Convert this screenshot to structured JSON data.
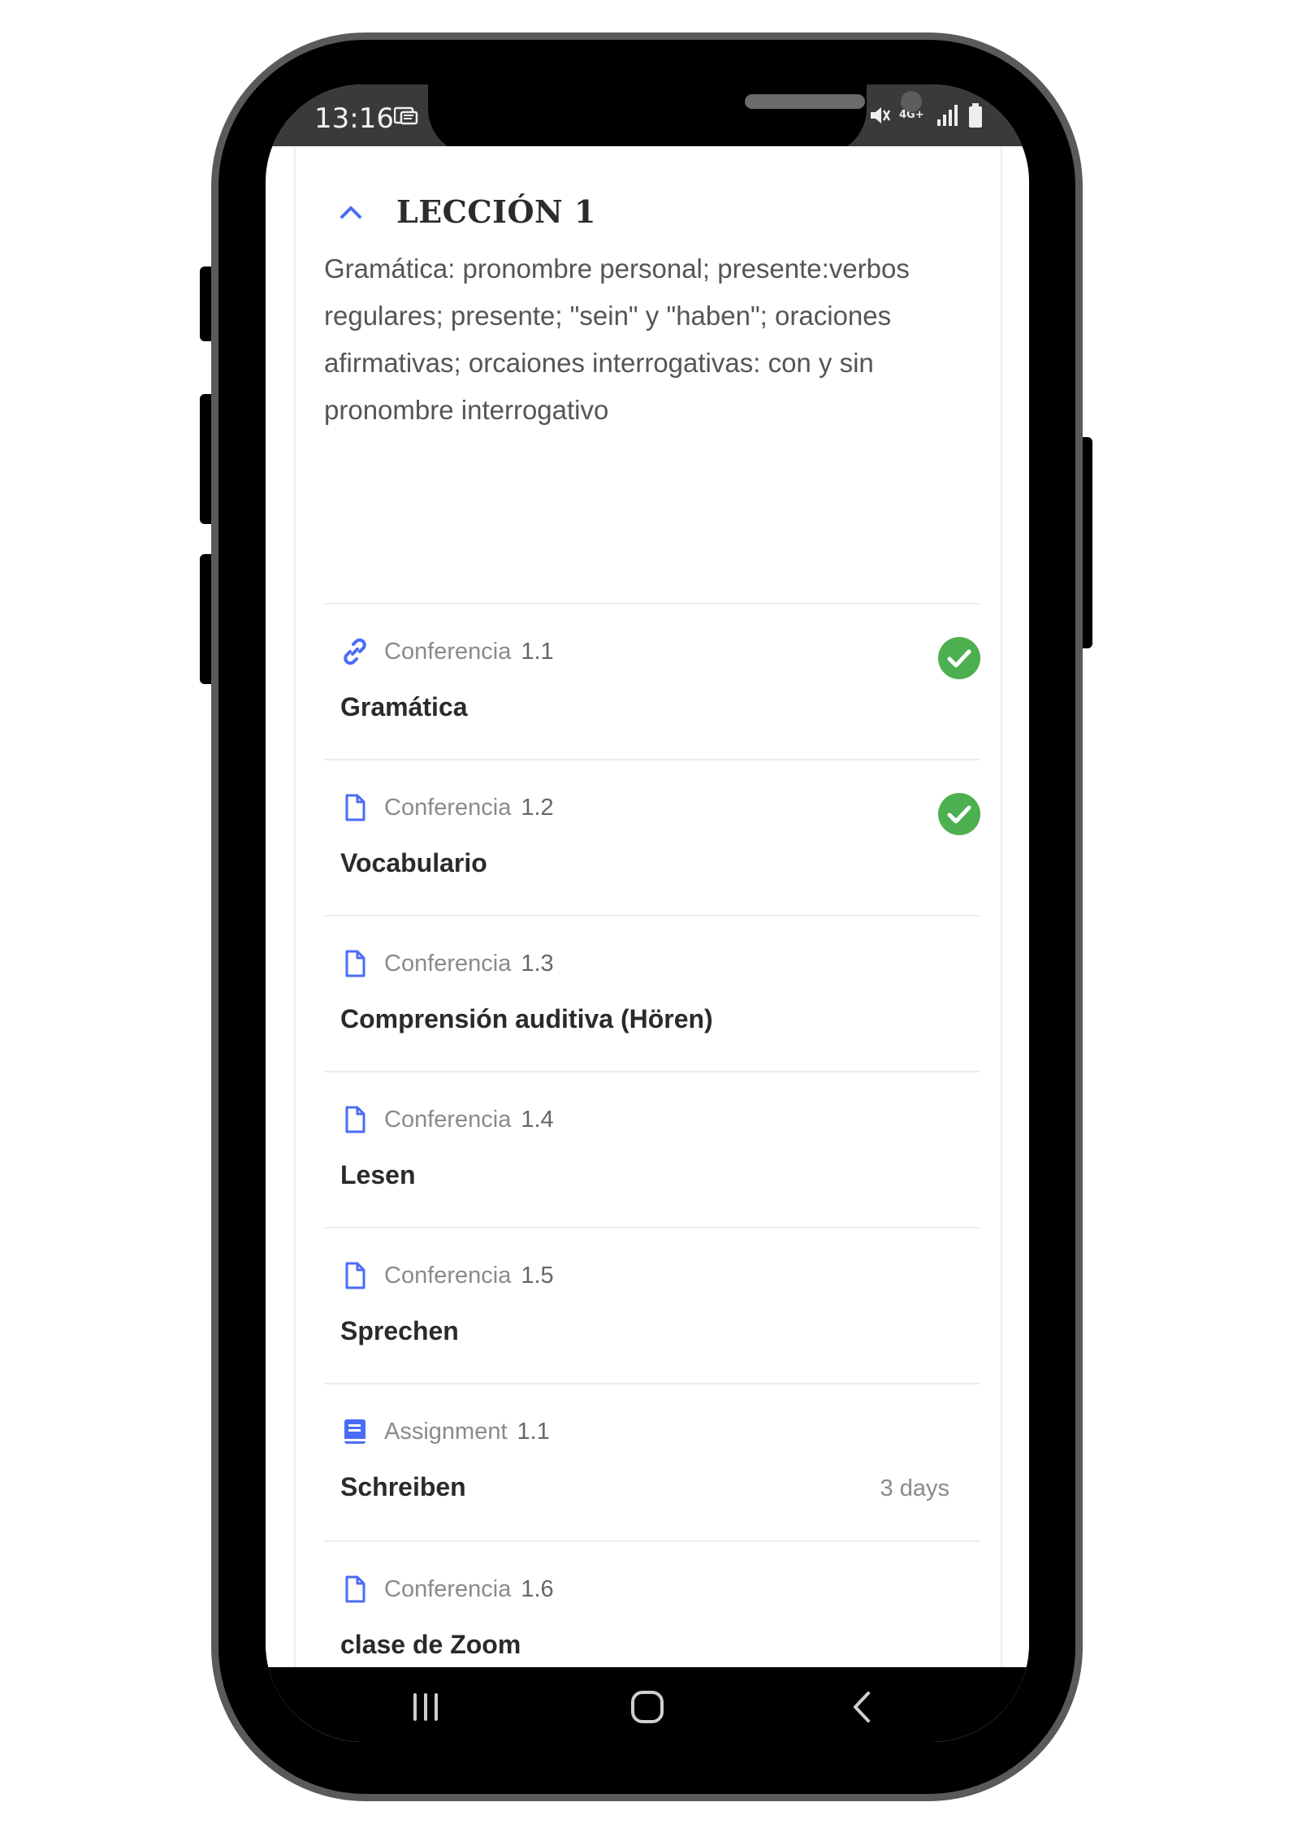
{
  "status_bar": {
    "time": "13:16",
    "icons": [
      "message-icon",
      "mute-icon",
      "4g-icon",
      "signal-icon",
      "battery-icon"
    ],
    "network_label": "4G+"
  },
  "section": {
    "title": "LECCIÓN 1",
    "description": "Gramática: pronombre personal; presente:verbos regulares; presente; \"sein\" y \"haben\"; oraciones afirmativas; orcaiones interrogativas: con y sin pronombre interrogativo",
    "expanded": true
  },
  "items": [
    {
      "kind": "Conferencia",
      "number": "1.1",
      "title": "Gramática",
      "icon": "link-icon",
      "completed": true
    },
    {
      "kind": "Conferencia",
      "number": "1.2",
      "title": "Vocabulario",
      "icon": "file-icon",
      "completed": true
    },
    {
      "kind": "Conferencia",
      "number": "1.3",
      "title": "Comprensión auditiva (Hören)",
      "icon": "file-icon",
      "completed": false
    },
    {
      "kind": "Conferencia",
      "number": "1.4",
      "title": "Lesen",
      "icon": "file-icon",
      "completed": false
    },
    {
      "kind": "Conferencia",
      "number": "1.5",
      "title": "Sprechen",
      "icon": "file-icon",
      "completed": false
    },
    {
      "kind": "Assignment",
      "number": "1.1",
      "title": "Schreiben",
      "icon": "book-icon",
      "completed": false,
      "due": "3 days"
    },
    {
      "kind": "Conferencia",
      "number": "1.6",
      "title": "clase de Zoom",
      "icon": "file-icon",
      "completed": false
    }
  ],
  "colors": {
    "accent": "#4a6cf7",
    "success": "#4caf50",
    "statusbar": "#3a3a3a"
  },
  "nav": {
    "buttons": [
      "recents-icon",
      "home-icon",
      "back-icon"
    ]
  }
}
